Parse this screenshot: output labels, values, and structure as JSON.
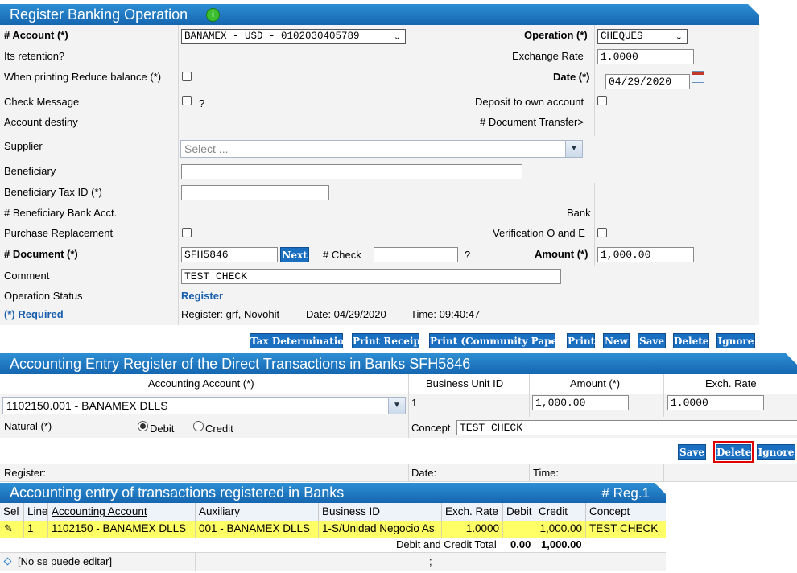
{
  "register": {
    "title": "Register Banking Operation",
    "account_label": "# Account (*)",
    "account_value": "BANAMEX - USD - 0102030405789",
    "operation_label": "Operation (*)",
    "operation_value": "CHEQUES",
    "retention_label": "Its retention?",
    "exchange_rate_label": "Exchange Rate",
    "exchange_rate_value": "1.0000",
    "reduce_balance_label": "When printing Reduce balance (*)",
    "date_label": "Date (*)",
    "date_value": "04/29/2020",
    "check_message_label": "Check Message",
    "check_message_help": "?",
    "deposit_own_label": "Deposit to own account",
    "account_destiny_label": "Account destiny",
    "document_transfer_label": "# Document Transfer>",
    "supplier_label": "Supplier",
    "supplier_placeholder": "Select ...",
    "beneficiary_label": "Beneficiary",
    "beneficiary_tax_label": "Beneficiary Tax ID (*)",
    "beneficiary_bank_label": "# Beneficiary Bank Acct.",
    "bank_label": "Bank",
    "purchase_replacement_label": "Purchase Replacement",
    "verification_label": "Verification O and E",
    "document_label": "# Document (*)",
    "document_value": "SFH5846",
    "next_label": "Next",
    "check_label": "# Check",
    "check_help": "?",
    "amount_label": "Amount (*)",
    "amount_value": "1,000.00",
    "comment_label": "Comment",
    "comment_value": "TEST CHECK",
    "operation_status_label": "Operation Status",
    "operation_status_value": "Register",
    "required_label": "(*) Required",
    "register_info": "Register: grf, Novohit",
    "date_info": "Date: 04/29/2020",
    "time_info": "Time: 09:40:47",
    "buttons": {
      "tax": "Tax Determination",
      "print_receipt": "Print Receipt",
      "print_community": "Print (Community Paper)",
      "print": "Print",
      "new": "New",
      "save": "Save",
      "delete": "Delete",
      "ignore": "Ignore"
    }
  },
  "entry": {
    "title": "Accounting Entry Register of the Direct Transactions in Banks SFH5846",
    "headers": {
      "account": "Accounting Account (*)",
      "business_unit": "Business Unit ID",
      "amount": "Amount (*)",
      "exch_rate": "Exch. Rate"
    },
    "account_value": "1102150.001 - BANAMEX DLLS",
    "business_unit_value": "1",
    "amount_value": "1,000.00",
    "exch_rate_value": "1.0000",
    "natural_label": "Natural (*)",
    "debit_label": "Debit",
    "credit_label": "Credit",
    "concept_label": "Concept",
    "concept_value": "TEST CHECK",
    "save": "Save",
    "delete": "Delete",
    "ignore": "Ignore",
    "register_label": "Register:",
    "date_label": "Date:",
    "time_label": "Time:"
  },
  "list": {
    "title": "Accounting entry of transactions registered in Banks",
    "reg_count": "# Reg.1",
    "columns": [
      "Sel",
      "Line",
      "Accounting Account",
      "Auxiliary",
      "Business ID",
      "Exch. Rate",
      "Debit",
      "Credit",
      "Concept"
    ],
    "row": {
      "line": "1",
      "account": "1102150 - BANAMEX DLLS",
      "auxiliary": "001 - BANAMEX DLLS",
      "business": "1-S/Unidad Negocio As",
      "exch_rate": "1.0000",
      "debit": "",
      "credit": "1,000.00",
      "concept": "TEST CHECK"
    },
    "total_label": "Debit and Credit Total",
    "total_debit": "0.00",
    "total_credit": "1,000.00",
    "footer_note": "[No se puede editar]",
    "footer_sep": ";"
  },
  "colors": {
    "header_blue": "#1a6fc0",
    "row_highlight": "#ffff66",
    "delete_outline": "#e00000"
  }
}
